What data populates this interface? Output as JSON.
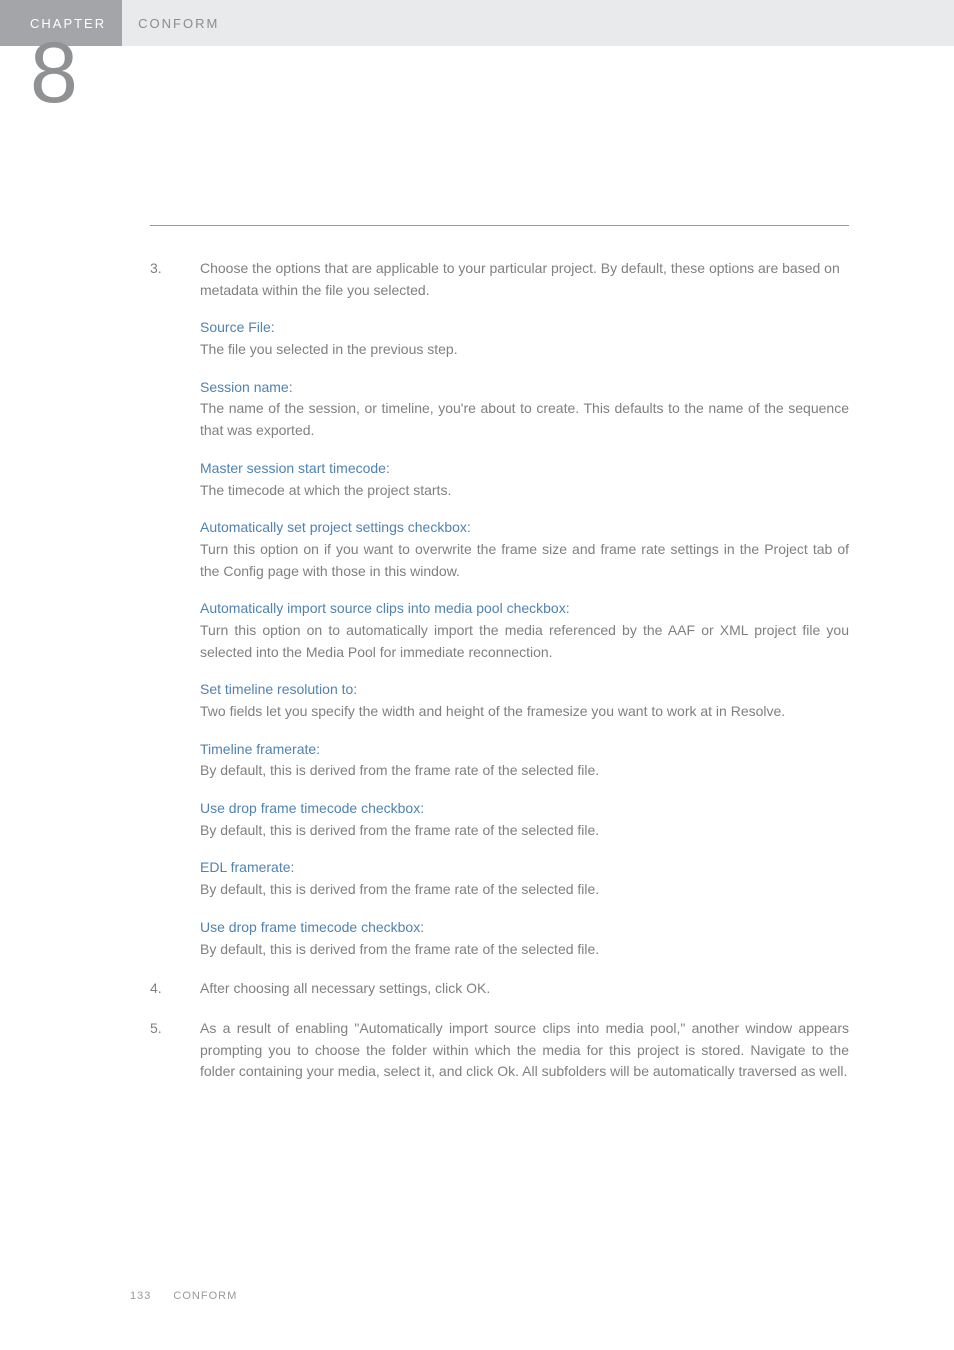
{
  "header": {
    "chapter_label": "CHAPTER",
    "title": "CONFORM",
    "chapter_number": "8"
  },
  "steps": [
    {
      "num": "3.",
      "intro": "Choose the options that are applicable to your particular project. By default, these options are based on metadata within the file you selected.",
      "options": [
        {
          "title": "Source File:",
          "body": "The file you selected in the previous step.",
          "justify": false
        },
        {
          "title": "Session name:",
          "body": "The name of the session, or timeline, you're about to create. This defaults to the name of the sequence that was exported.",
          "justify": true
        },
        {
          "title": "Master session start timecode:",
          "body": "The timecode at which the project starts.",
          "justify": false
        },
        {
          "title": "Automatically set project settings checkbox:",
          "body": "Turn this option on if you want to overwrite the frame size and frame rate settings in the Project tab of the Config page with those in this window.",
          "justify": true
        },
        {
          "title": "Automatically import source clips into media pool checkbox:",
          "body": "Turn this option on to automatically import the media referenced by the AAF or XML project file you selected into the Media Pool for immediate reconnection.",
          "justify": true
        },
        {
          "title": "Set timeline resolution to:",
          "body": "Two fields let you specify the width and height of the framesize you want to work at in Resolve.",
          "justify": true
        },
        {
          "title": "Timeline framerate:",
          "body": "By default, this is derived from the frame rate of the selected file.",
          "justify": false
        },
        {
          "title": "Use drop frame timecode checkbox:",
          "body": "By default, this is derived from the frame rate of the selected file.",
          "justify": false
        },
        {
          "title": "EDL framerate:",
          "body": "By default, this is derived from the frame rate of the selected file.",
          "justify": false
        },
        {
          "title": "Use drop frame timecode checkbox:",
          "body": "By default, this is derived from the frame rate of the selected file.",
          "justify": false
        }
      ]
    },
    {
      "num": "4.",
      "intro": "After choosing all necessary settings, click OK."
    },
    {
      "num": "5.",
      "intro": "As a result of enabling \"Automatically import source clips into media pool,\" another window appears prompting you to choose the folder within which the media for this project is stored. Navigate to the folder containing your media, select it, and click Ok. All subfolders will be automatically traversed as well.",
      "justify": true
    }
  ],
  "footer": {
    "page_number": "133",
    "section": "CONFORM"
  }
}
